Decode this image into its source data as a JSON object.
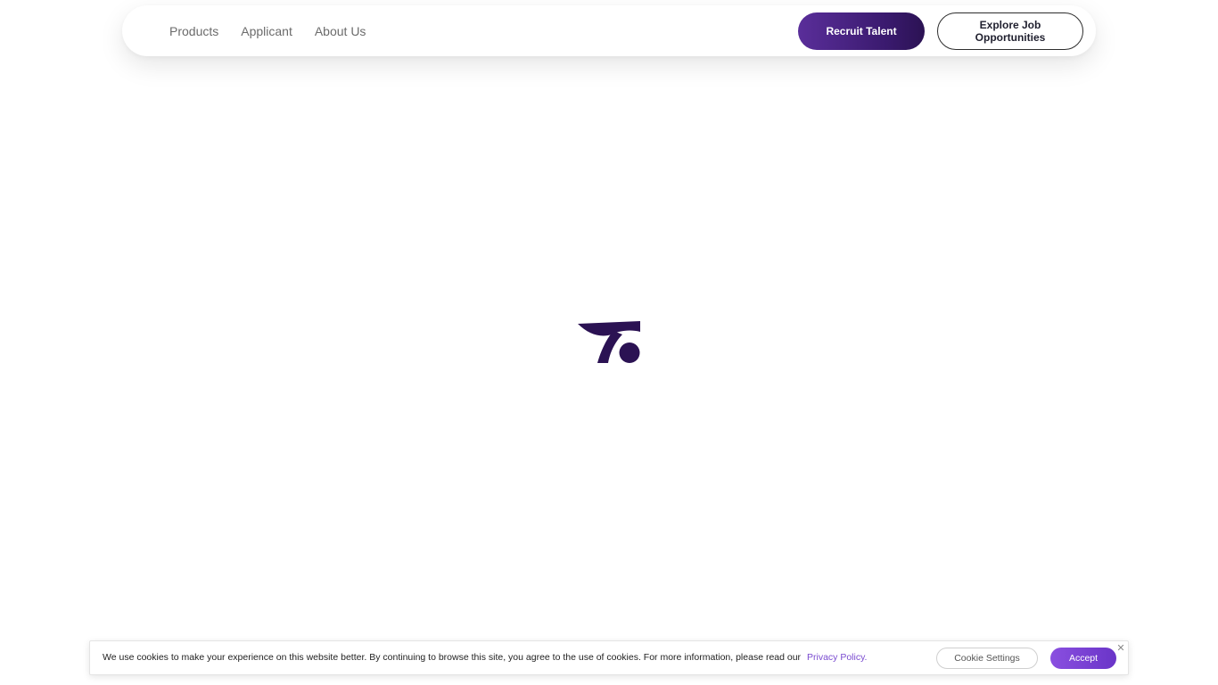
{
  "nav": {
    "links": [
      "Products",
      "Applicant",
      "About Us"
    ],
    "recruit_label": "Recruit Talent",
    "explore_label": "Explore Job Opportunities"
  },
  "loader": {
    "icon": "brand-logo-icon",
    "color": "#2b1253"
  },
  "cookie": {
    "text": "We use cookies to make your experience on this website better. By continuing to browse this site, you agree to the use of cookies. For more information, please read our",
    "link_label": "Privacy Policy.",
    "settings_label": "Cookie Settings",
    "accept_label": "Accept",
    "close_icon": "close-icon"
  },
  "colors": {
    "brand_dark": "#2b1253",
    "brand_purple": "#5a2e9a",
    "accept_purple": "#7a45d6",
    "link_purple": "#7a4bd0"
  }
}
